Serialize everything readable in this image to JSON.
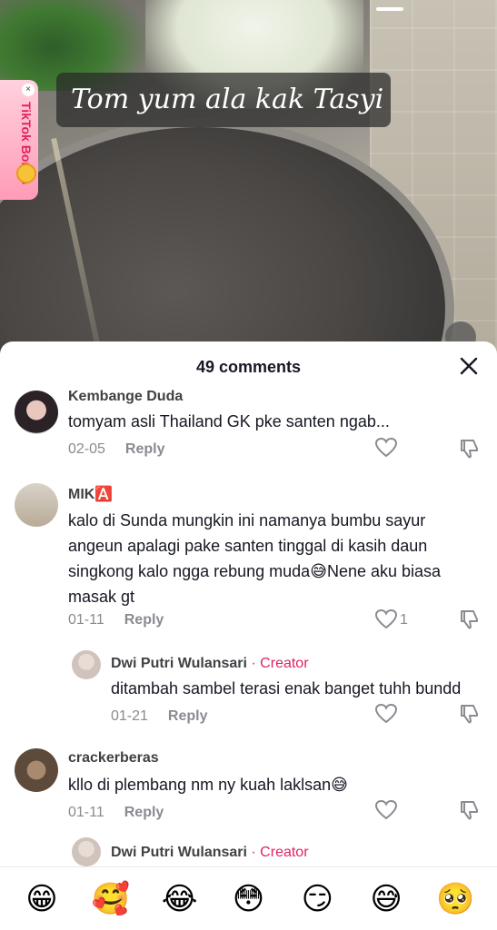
{
  "video": {
    "caption": "Tom yum ala kak Tasyi",
    "bonus_label": "TikTok Bonus"
  },
  "comments_panel": {
    "title": "49 comments"
  },
  "comments": [
    {
      "username": "Kembange Duda",
      "text": "tomyam asli Thailand GK pke santen ngab...",
      "date": "02-05",
      "reply_label": "Reply",
      "likes": ""
    },
    {
      "username": "MIK🅰️",
      "text": "kalo di Sunda mungkin ini namanya bumbu sayur angeun apalagi pake santen tinggal di kasih daun singkong kalo ngga rebung muda😅Nene aku biasa masak gt",
      "date": "01-11",
      "reply_label": "Reply",
      "likes": "1",
      "reply": {
        "username": "Dwi Putri Wulansari",
        "badge": "· Creator",
        "text": "ditambah sambel terasi enak banget tuhh bundd",
        "date": "01-21",
        "reply_label": "Reply"
      }
    },
    {
      "username": "crackerberas",
      "text": "kllo di plembang nm ny kuah laklsan😅",
      "date": "01-11",
      "reply_label": "Reply",
      "likes": "",
      "reply": {
        "username": "Dwi Putri Wulansari",
        "badge": "· Creator"
      }
    }
  ],
  "emoji_bar": [
    "😁",
    "🥰",
    "😂",
    "😳",
    "😏",
    "😅",
    "🥺"
  ],
  "colors": {
    "creator": "#e0245e",
    "meta": "#8a8b91",
    "text": "#161823"
  }
}
